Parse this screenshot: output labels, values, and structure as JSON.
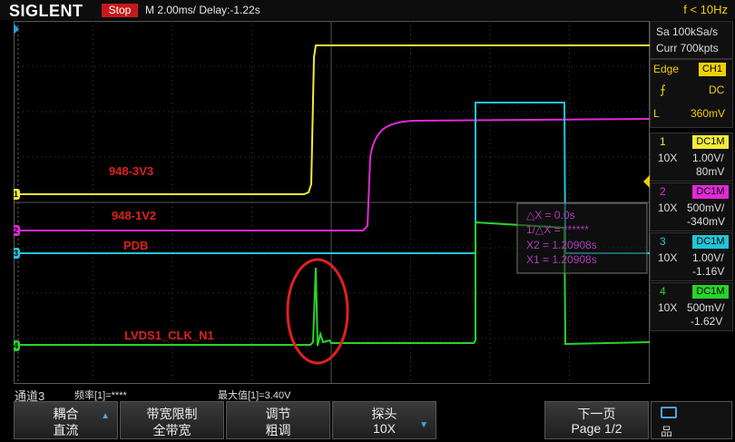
{
  "header": {
    "brand": "SIGLENT",
    "run_state": "Stop",
    "timebase": "M 2.00ms/ Delay:-1.22s",
    "trigger_freq": "f < 10Hz"
  },
  "acquisition": {
    "sample_rate": "Sa 100kSa/s",
    "memory": "Curr 700kpts"
  },
  "trigger": {
    "type": "Edge",
    "source": "CH1",
    "coupling": "DC",
    "level_prefix": "L",
    "level": "360mV"
  },
  "channels": [
    {
      "num": "1",
      "coupling": "DC1M",
      "probe": "10X",
      "scale": "1.00V/",
      "offset": "80mV",
      "color": "#f2ea3a"
    },
    {
      "num": "2",
      "coupling": "DC1M",
      "probe": "10X",
      "scale": "500mV/",
      "offset": "-340mV",
      "color": "#e02ad6"
    },
    {
      "num": "3",
      "coupling": "DC1M",
      "probe": "10X",
      "scale": "1.00V/",
      "offset": "-1.16V",
      "color": "#22c4d8"
    },
    {
      "num": "4",
      "coupling": "DC1M",
      "probe": "10X",
      "scale": "500mV/",
      "offset": "-1.62V",
      "color": "#27d42a"
    }
  ],
  "channel_markers": [
    "1",
    "2",
    "3",
    "4"
  ],
  "trace_labels": [
    "948-3V3",
    "948-1V2",
    "PDB",
    "LVDS1_CLK_N1"
  ],
  "cursor_readout": {
    "dx": "△X = 0.0s",
    "inv_dx": "1/△X = ******",
    "x2": "X2 = 1.20908s",
    "x1": "X1 = 1.20908s"
  },
  "status": {
    "channel": "通道3",
    "frequency": "频率[1]=****",
    "max_value": "最大值[1]=3.40V"
  },
  "menu": [
    {
      "label": "耦合",
      "value": "直流"
    },
    {
      "label": "带宽限制",
      "value": "全带宽"
    },
    {
      "label": "调节",
      "value": "粗调"
    },
    {
      "label": "探头",
      "value": "10X"
    },
    {
      "label": "下一页",
      "value": "Page 1/2"
    }
  ],
  "colors": {
    "accent": "#f0d000",
    "stop": "#c41a1a",
    "annotation": "#e02020",
    "grid": "#3c3c3c"
  }
}
